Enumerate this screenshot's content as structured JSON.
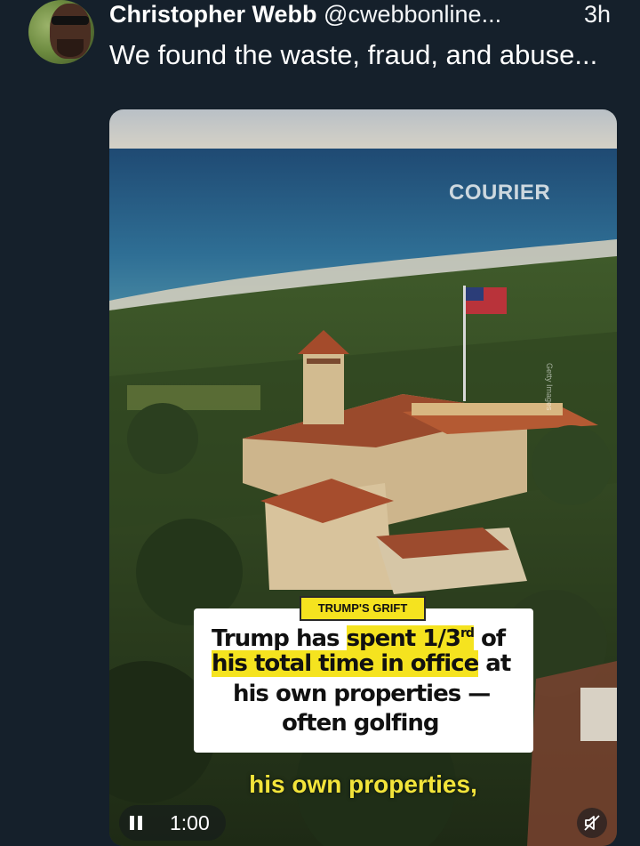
{
  "post": {
    "author_name": "Christopher Webb",
    "author_handle": "@cwebbonline",
    "handle_truncation": "...",
    "time": "3h",
    "text": "We found the waste, fraud, and abuse..."
  },
  "video": {
    "watermark": "COURIER",
    "photo_credit": "Getty Images",
    "tag": "TRUMP'S GRIFT",
    "headline": {
      "line1_a": "Trump has ",
      "line1_b": "spent 1/3",
      "line1_sup": "rd",
      "line1_c": " of",
      "line2_a": "his total time in office",
      "line2_b": " at",
      "line3": "his own properties —",
      "line4": "often golfing"
    },
    "caption": "his own properties,",
    "timecode": "1:00",
    "play_state_icon": "pause-icon",
    "mute_icon": "muted-speaker-icon"
  },
  "colors": {
    "background": "#15202b",
    "highlight": "#f5e31f",
    "caption": "#f3e43a"
  }
}
